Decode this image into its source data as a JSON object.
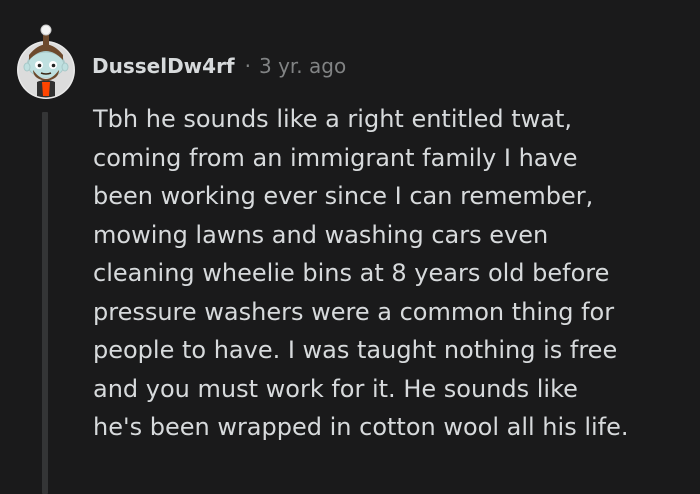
{
  "comment": {
    "author": "DusselDw4rf",
    "separator": "·",
    "timestamp": "3 yr. ago",
    "avatar_icon": "snoo-avatar-icon",
    "lines": [
      "Tbh he sounds like a right entitled twat,",
      "coming from an immigrant family I have",
      "been working ever since I can remember,",
      "mowing lawns and washing cars even",
      "cleaning wheelie bins at 8 years old before",
      "pressure washers were a common thing for",
      "people to have. I was taught nothing is free",
      "and you must work for it. He sounds like",
      "he's been wrapped in cotton wool all his life."
    ]
  },
  "colors": {
    "background": "#1a1a1b",
    "text": "#d7dadc",
    "meta": "#818384",
    "thread_line": "#343536"
  }
}
